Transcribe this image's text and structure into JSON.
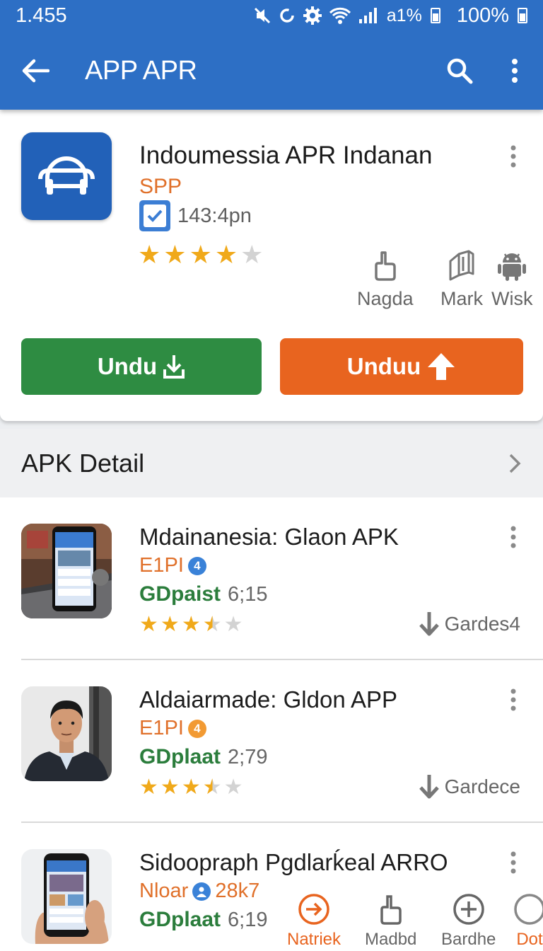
{
  "status_bar": {
    "time": "1.455",
    "signal_text": "a1%",
    "battery": "100%"
  },
  "app_bar": {
    "title": "APP APR"
  },
  "hero": {
    "title": "Indoumessia APR Indanan",
    "subtitle": "SPP",
    "meta_time": "143:4pn",
    "rating": 4,
    "actions": [
      {
        "label": "Nagda",
        "icon": "thumb-icon"
      },
      {
        "label": "Mark",
        "icon": "mark-icon"
      },
      {
        "label": "Wisk",
        "icon": "android-icon"
      }
    ],
    "primary_button": "Undu",
    "secondary_button": "Unduu",
    "colors": {
      "accent": "#2d6fc5",
      "green": "#2e8c42",
      "orange": "#e8641f"
    }
  },
  "section": {
    "label": "APK Detail"
  },
  "items": [
    {
      "title": "Mdainanesia: Glaon APK",
      "category": "E1PI",
      "badge": "4",
      "developer": "GDpaist",
      "version": "6;15",
      "rating": 3.5,
      "download_label": "Gardes4"
    },
    {
      "title": "Aldaiarmade: Gldon APP",
      "category": "E1PI",
      "badge": "4",
      "developer": "GDplaat",
      "version": "2;79",
      "rating": 3.5,
      "download_label": "Gardece"
    },
    {
      "title": "Sidoopraph Pgdlarḱeal ARRO",
      "category": "Nloar",
      "badge": "28k7",
      "developer": "GDplaat",
      "version": "6;19"
    }
  ],
  "bottom_nav": [
    {
      "label": "Natriek",
      "icon": "arrow-circle-icon",
      "color": "#e8641f"
    },
    {
      "label": "Madbd",
      "icon": "thumb-icon",
      "color": "#666666"
    },
    {
      "label": "Bardhe",
      "icon": "plus-circle-icon",
      "color": "#666666"
    },
    {
      "label": "Dot",
      "icon": "circle-icon",
      "color": "#e8641f"
    }
  ]
}
